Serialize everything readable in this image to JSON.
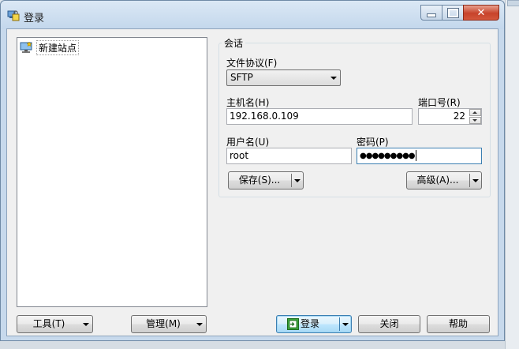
{
  "window": {
    "title": "登录"
  },
  "site_tree": {
    "items": [
      {
        "label": "新建站点",
        "icon": "computer-site-icon"
      }
    ]
  },
  "session": {
    "group_title": "会话",
    "protocol": {
      "label": "文件协议(F)",
      "value": "SFTP"
    },
    "host": {
      "label": "主机名(H)",
      "value": "192.168.0.109"
    },
    "port": {
      "label": "端口号(R)",
      "value": "22"
    },
    "username": {
      "label": "用户名(U)",
      "value": "root"
    },
    "password": {
      "label": "密码(P)",
      "value": "●●●●●●●●●"
    },
    "save_button": "保存(S)...",
    "advanced_button": "高级(A)..."
  },
  "bottom": {
    "tools_button": "工具(T)",
    "manage_button": "管理(M)",
    "login_button": "登录",
    "close_button": "关闭",
    "help_button": "帮助"
  },
  "colors": {
    "accent": "#3c7fb1",
    "titlebar": "#c7d9ec",
    "close": "#c7432b"
  }
}
